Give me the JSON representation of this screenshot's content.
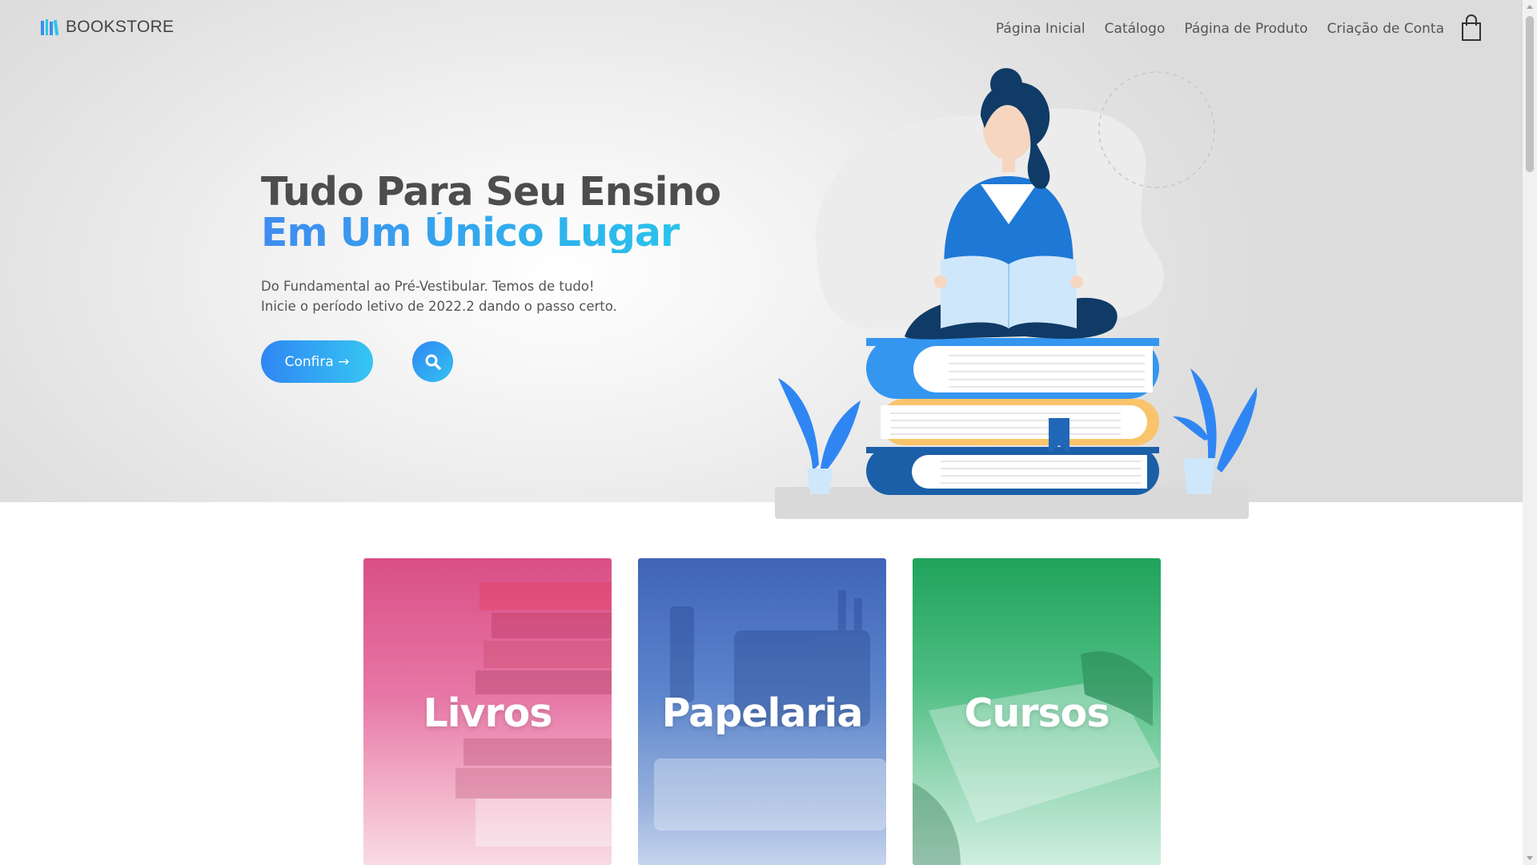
{
  "header": {
    "logo_text": "BOOKSTORE",
    "logo_icon": "books-icon",
    "nav": [
      {
        "label": "Página Inicial"
      },
      {
        "label": "Catálogo"
      },
      {
        "label": "Página de Produto"
      },
      {
        "label": "Criação de Conta"
      }
    ],
    "cart_icon": "shopping-bag-icon"
  },
  "hero": {
    "title_line1": "Tudo Para Seu Ensino",
    "title_line2": "Em Um Único Lugar",
    "subtitle_line1": "Do Fundamental ao Pré-Vestibular. Temos de tudo!",
    "subtitle_line2": "Inicie o período letivo de 2022.2 dando o passo certo.",
    "cta_label": "Confira →",
    "search_icon": "search-icon",
    "illustration": "woman-reading-on-books-illustration"
  },
  "categories": [
    {
      "label": "Livros"
    },
    {
      "label": "Papelaria"
    },
    {
      "label": "Cursos"
    }
  ],
  "colors": {
    "accent_blue": "#2f86f3",
    "accent_cyan": "#27c8ea",
    "heading": "#4d4d4d",
    "card_livros": "#d94f86",
    "card_papelaria": "#3f64b8",
    "card_cursos": "#20a35b"
  }
}
